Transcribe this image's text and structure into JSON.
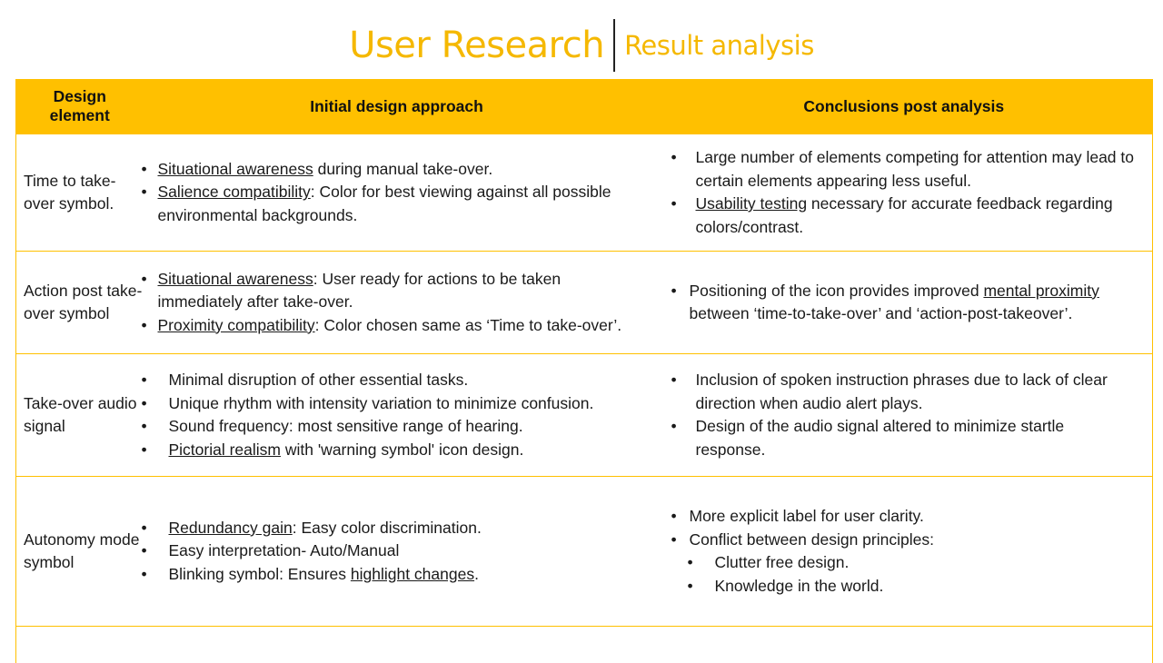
{
  "title": {
    "main": "User Research",
    "sub": "Result analysis"
  },
  "colors": {
    "accent": "#ffc000",
    "title": "#f5b800"
  },
  "headers": {
    "element": "Design element",
    "initial": "Initial design approach",
    "conclusions": "Conclusions  post analysis"
  },
  "rows": [
    {
      "element": "Time to take-over symbol.",
      "initial": [
        {
          "u": "Situational awareness",
          "t": " during manual take-over."
        },
        {
          "u": "Salience compatibility",
          "t": ": Color for best viewing against all possible environmental  backgrounds."
        }
      ],
      "conclusions": [
        {
          "u": "",
          "t": "Large number of elements competing for attention may lead to certain elements appearing less useful."
        },
        {
          "u": "Usability testing",
          "t": " necessary  for accurate feedback regarding colors/contrast."
        }
      ]
    },
    {
      "element": "Action post take-over symbol",
      "initial": [
        {
          "u": "Situational awareness",
          "t": ": User ready for actions to be taken immediately after take-over."
        },
        {
          "u": "Proximity compatibility",
          "t": ": Color chosen same as ‘Time to take-over’."
        }
      ],
      "conclusions": [
        {
          "pre": "Positioning of the icon provides improved ",
          "u": "mental proximity",
          "t": " between  ‘time-to-take-over’  and ‘action-post-takeover’."
        }
      ]
    },
    {
      "element": "Take-over audio signal",
      "initial": [
        {
          "u": "",
          "t": "Minimal disruption of other essential tasks."
        },
        {
          "u": "",
          "t": "Unique rhythm with intensity variation to minimize confusion."
        },
        {
          "u": "",
          "t": "Sound frequency:  most sensitive range of hearing."
        },
        {
          "u": "Pictorial realism",
          "t": " with 'warning symbol' icon design."
        }
      ],
      "conclusions": [
        {
          "u": "",
          "t": "Inclusion of spoken instruction phrases due to lack of clear direction when audio alert plays."
        },
        {
          "u": "",
          "t": "Design of the audio signal altered to minimize startle response."
        }
      ]
    },
    {
      "element": "Autonomy mode symbol",
      "initial": [
        {
          "u": "Redundancy gain",
          "t": ": Easy color discrimination."
        },
        {
          "u": "",
          "t": "Easy interpretation- Auto/Manual"
        },
        {
          "pre": "Blinking symbol: Ensures  ",
          "u": "highlight changes",
          "t": "."
        }
      ],
      "conclusions": [
        {
          "u": "",
          "t": "More explicit label for user clarity."
        },
        {
          "u": "",
          "t": "Conflict between design principles:"
        }
      ],
      "conclusions_sub": [
        "Clutter free design.",
        "Knowledge  in the world."
      ]
    }
  ]
}
